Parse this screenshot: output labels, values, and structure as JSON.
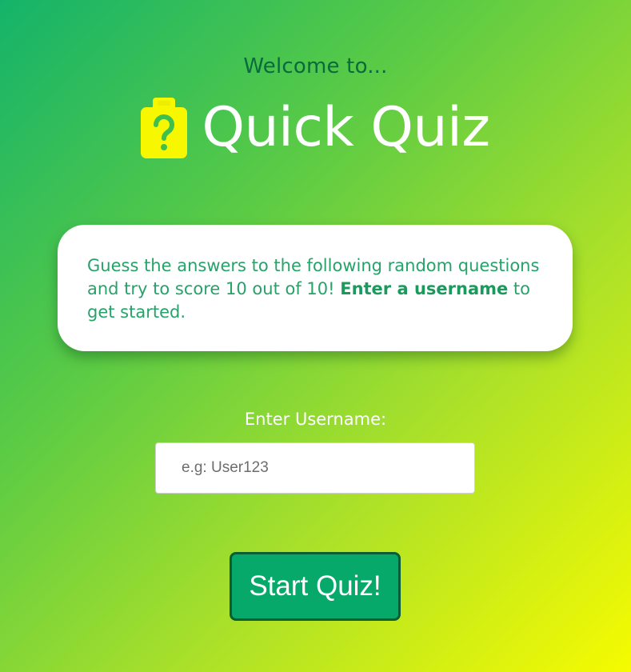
{
  "header": {
    "welcome": "Welcome to...",
    "title": "Quick Quiz",
    "logo_icon": "clipboard-question-icon"
  },
  "intro": {
    "text_part1": "Guess the answers to the following random questions and try to score 10 out of 10! ",
    "text_bold": "Enter a username",
    "text_part2": " to get started."
  },
  "form": {
    "username_label": "Enter Username:",
    "username_placeholder": "e.g: User123",
    "username_value": "",
    "start_button_label": "Start Quiz!"
  },
  "colors": {
    "gradient_start": "#14b36a",
    "gradient_end": "#f6fb00",
    "logo_yellow": "#f7f700",
    "accent_green": "#27a269",
    "button_green": "#06a96a",
    "button_border": "#0a5e35"
  }
}
